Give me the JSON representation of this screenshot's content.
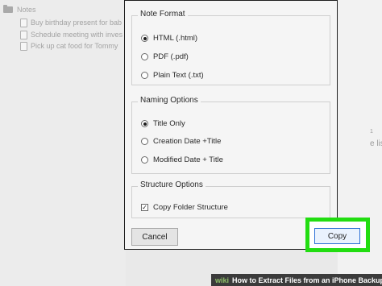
{
  "background": {
    "folder_label": "Notes",
    "notes": [
      "Buy birthday present for bab",
      "Schedule meeting with inves",
      "Pick up cat food for Tommy"
    ],
    "right_fragment": "e list",
    "right_mark": "1"
  },
  "dialog": {
    "note_format": {
      "title": "Note Format",
      "options": [
        "HTML (.html)",
        "PDF (.pdf)",
        "Plain Text (.txt)"
      ],
      "selected": "HTML (.html)"
    },
    "naming_options": {
      "title": "Naming Options",
      "options": [
        "Title Only",
        "Creation Date +Title",
        "Modified Date + Title"
      ],
      "selected": "Title Only"
    },
    "structure_options": {
      "title": "Structure Options",
      "checkbox_label": "Copy Folder Structure",
      "checked": true,
      "check_mark": "✓"
    },
    "cancel_label": "Cancel",
    "copy_label": "Copy"
  },
  "watermark": {
    "logo": "wiki",
    "text": "How to Extract Files from an iPhone Backup"
  },
  "colors": {
    "highlight": "#22dd11",
    "dialog_border": "#1e1e1e"
  }
}
